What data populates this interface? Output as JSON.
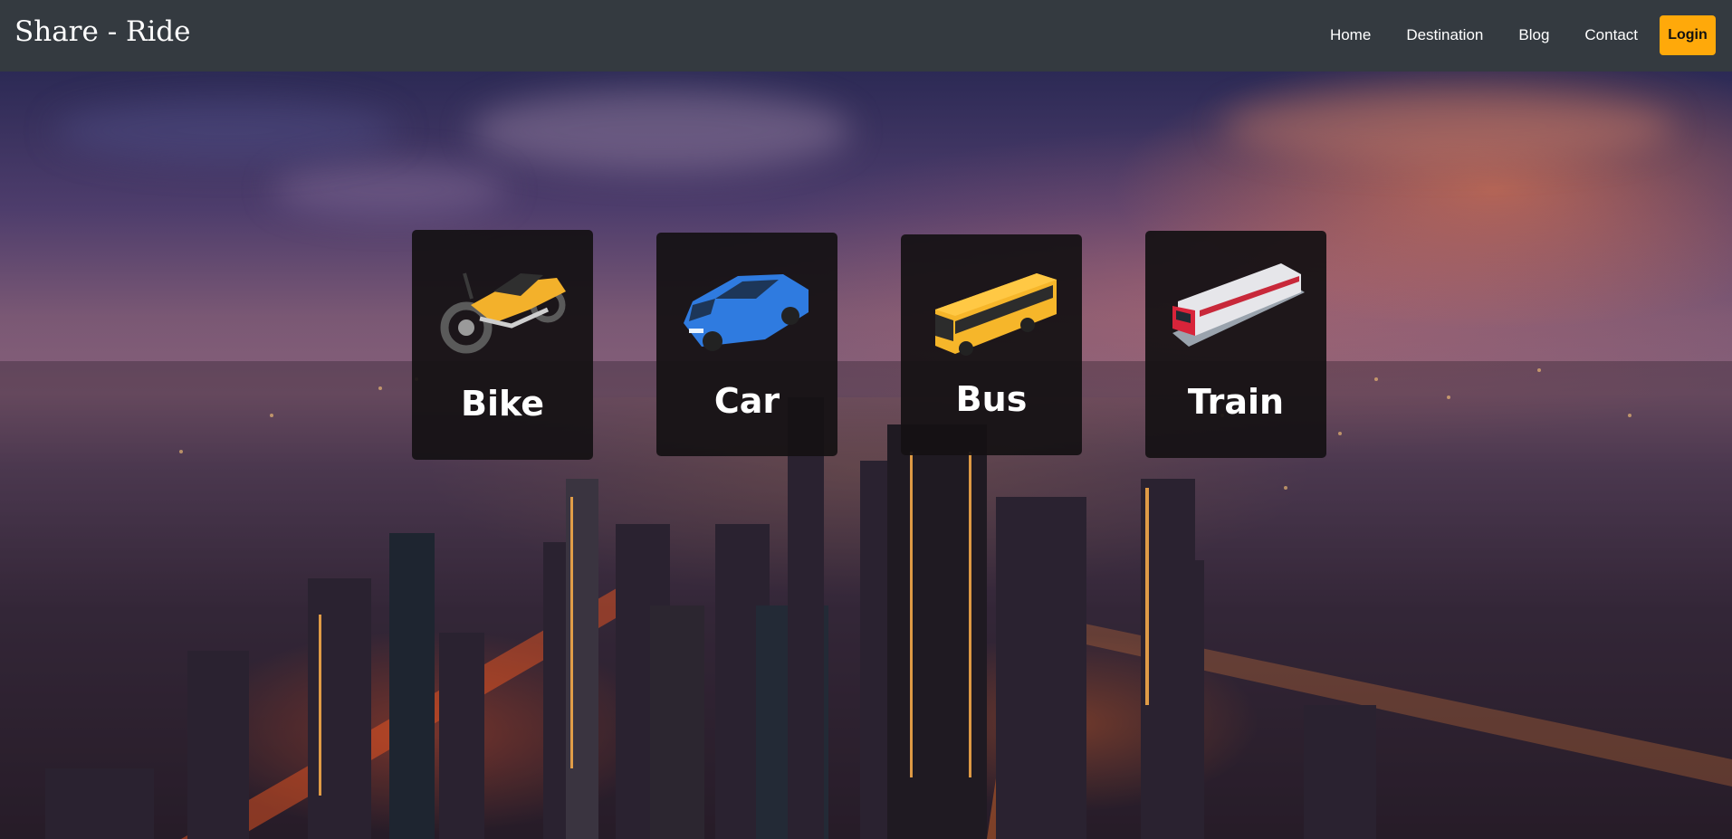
{
  "navbar": {
    "brand": "Share - Ride",
    "links": [
      "Home",
      "Destination",
      "Blog",
      "Contact"
    ],
    "login_label": "Login"
  },
  "colors": {
    "navbar_bg": "#343a40",
    "login_bg": "#ffa90a",
    "card_bg": "#141113"
  },
  "cards": [
    {
      "label": "Bike",
      "icon": "motorcycle-icon"
    },
    {
      "label": "Car",
      "icon": "car-icon"
    },
    {
      "label": "Bus",
      "icon": "bus-icon"
    },
    {
      "label": "Train",
      "icon": "train-icon"
    }
  ]
}
